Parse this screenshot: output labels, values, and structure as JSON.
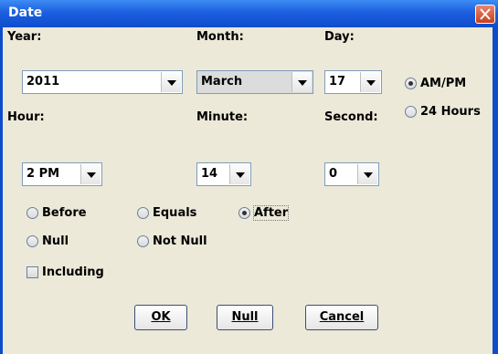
{
  "dialog": {
    "title": "Date"
  },
  "fields": {
    "year": {
      "label": "Year:",
      "value": "2011"
    },
    "month": {
      "label": "Month:",
      "value": "March"
    },
    "day": {
      "label": "Day:",
      "value": "17"
    },
    "hour": {
      "label": "Hour:",
      "value": "2 PM"
    },
    "minute": {
      "label": "Minute:",
      "value": "14"
    },
    "second": {
      "label": "Second:",
      "value": "0"
    }
  },
  "time_format": {
    "ampm": "AM/PM",
    "hours24": "24 Hours",
    "selected": "AM/PM"
  },
  "comparison": {
    "before": "Before",
    "equals": "Equals",
    "after": "After",
    "null": "Null",
    "not_null": "Not Null",
    "selected": "After"
  },
  "including": {
    "label": "Including",
    "checked": false
  },
  "buttons": {
    "ok": "OK",
    "null": "Null",
    "cancel": "Cancel"
  },
  "colors": {
    "titlebar": "#0d4ccd",
    "dialog_bg": "#ece9d8",
    "close": "#c8401e"
  }
}
